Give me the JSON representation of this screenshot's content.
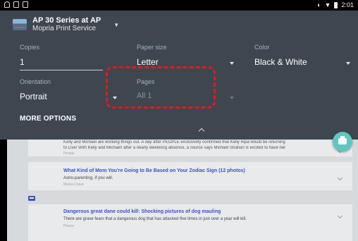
{
  "status_bar": {
    "left_icons": [
      "app-notification-icon",
      "image-icon",
      "sim-icon"
    ],
    "right_icons": [
      "vpn-key-icon",
      "wifi-icon",
      "battery-icon"
    ],
    "time": "2:01"
  },
  "printer": {
    "name": "AP 30 Series at AP",
    "service": "Mopria Print Service"
  },
  "fields": {
    "copies": {
      "label": "Copies",
      "value": "1"
    },
    "paper_size": {
      "label": "Paper size",
      "value": "Letter"
    },
    "color": {
      "label": "Color",
      "value": "Black & White"
    },
    "orientation": {
      "label": "Orientation",
      "value": "Portrait"
    },
    "pages": {
      "label": "Pages",
      "value": "All 1"
    }
  },
  "more_options": "MORE OPTIONS",
  "feed": {
    "card1": {
      "text1": "Kelly and Michael are working things out. A day after PEOPLE exclusively confirmed that Kelly Ripa would be returning",
      "text2": "to Live! With Kelly and Michael! after a nearly weeklong absence, a source says Michael Strahan is excited to have her",
      "tag": "People"
    },
    "card2": {
      "title": "What Kind of Mom You're Going to Be Based on Your Zodiac Sign (12 photos)",
      "sub": "Astro-parenting, if you will.",
      "tag": "Mama Crave"
    },
    "card3": {
      "title": "Dangerous great dane could kill: Shocking pictures of dog mauling",
      "sub": "There are grave fears that a dangerous dog that has attacked five times in just over a year will kill.",
      "tag": "Planes"
    }
  },
  "colors": {
    "panel_bg": "#3e474f",
    "highlight": "#e01b1b",
    "fab": "#5ec7c2",
    "link": "#3a52c2"
  }
}
